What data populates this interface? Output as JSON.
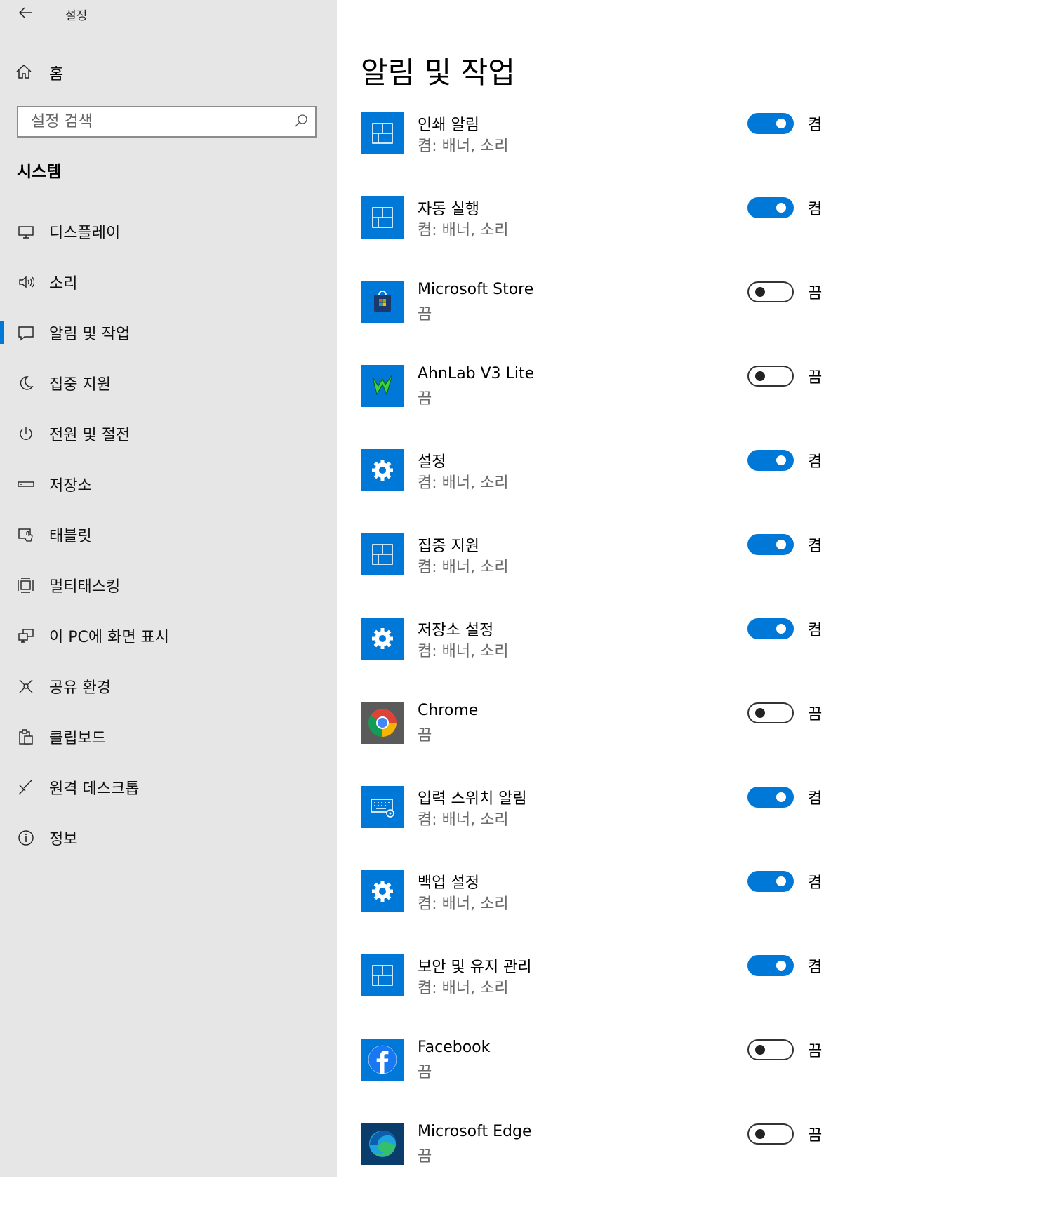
{
  "window": {
    "title": "설정"
  },
  "sidebar": {
    "home_label": "홈",
    "search_placeholder": "설정 검색",
    "section_title": "시스템",
    "items": [
      {
        "label": "디스플레이",
        "icon": "monitor-icon"
      },
      {
        "label": "소리",
        "icon": "speaker-icon"
      },
      {
        "label": "알림 및 작업",
        "icon": "message-icon",
        "active": true
      },
      {
        "label": "집중 지원",
        "icon": "moon-icon"
      },
      {
        "label": "전원 및 절전",
        "icon": "power-icon"
      },
      {
        "label": "저장소",
        "icon": "storage-icon"
      },
      {
        "label": "태블릿",
        "icon": "tablet-icon"
      },
      {
        "label": "멀티태스킹",
        "icon": "multitasking-icon"
      },
      {
        "label": "이 PC에 화면 표시",
        "icon": "project-icon"
      },
      {
        "label": "공유 환경",
        "icon": "share-icon"
      },
      {
        "label": "클립보드",
        "icon": "clipboard-icon"
      },
      {
        "label": "원격 데스크톱",
        "icon": "remote-desktop-icon"
      },
      {
        "label": "정보",
        "icon": "info-icon"
      }
    ]
  },
  "main": {
    "title": "알림 및 작업",
    "apps": [
      {
        "name": "인쇄 알림",
        "status": "켬: 배너, 소리",
        "toggle": "켬",
        "on": true,
        "icon": "windows-app-icon"
      },
      {
        "name": "자동 실행",
        "status": "켬: 배너, 소리",
        "toggle": "켬",
        "on": true,
        "icon": "windows-app-icon"
      },
      {
        "name": "Microsoft Store",
        "status": "끔",
        "toggle": "끔",
        "on": false,
        "icon": "store-icon"
      },
      {
        "name": "AhnLab V3 Lite",
        "status": "끔",
        "toggle": "끔",
        "on": false,
        "icon": "ahnlab-icon"
      },
      {
        "name": "설정",
        "status": "켬: 배너, 소리",
        "toggle": "켬",
        "on": true,
        "icon": "gear-icon"
      },
      {
        "name": "집중 지원",
        "status": "켬: 배너, 소리",
        "toggle": "켬",
        "on": true,
        "icon": "windows-app-icon"
      },
      {
        "name": "저장소 설정",
        "status": "켬: 배너, 소리",
        "toggle": "켬",
        "on": true,
        "icon": "gear-icon"
      },
      {
        "name": "Chrome",
        "status": "끔",
        "toggle": "끔",
        "on": false,
        "icon": "chrome-icon"
      },
      {
        "name": "입력 스위치 알림",
        "status": "켬: 배너, 소리",
        "toggle": "켬",
        "on": true,
        "icon": "keyboard-icon"
      },
      {
        "name": "백업 설정",
        "status": "켬: 배너, 소리",
        "toggle": "켬",
        "on": true,
        "icon": "gear-icon"
      },
      {
        "name": "보안 및 유지 관리",
        "status": "켬: 배너, 소리",
        "toggle": "켬",
        "on": true,
        "icon": "windows-app-icon"
      },
      {
        "name": "Facebook",
        "status": "끔",
        "toggle": "끔",
        "on": false,
        "icon": "facebook-icon"
      },
      {
        "name": "Microsoft Edge",
        "status": "끔",
        "toggle": "끔",
        "on": false,
        "icon": "edge-icon"
      }
    ]
  },
  "colors": {
    "accent": "#0078d7",
    "sidebar_bg": "#e6e6e6",
    "secondary_text": "#6b6b6b"
  }
}
